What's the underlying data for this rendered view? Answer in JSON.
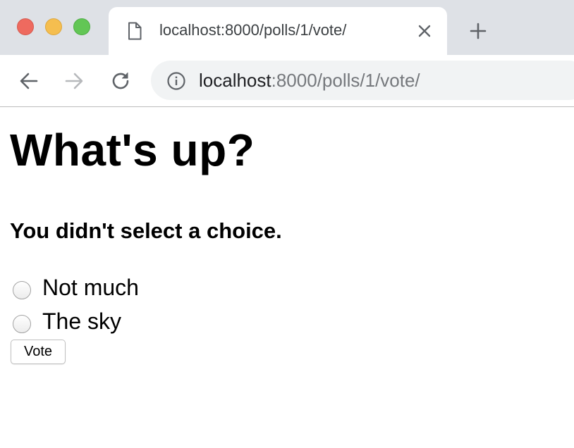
{
  "browser": {
    "tab": {
      "title": "localhost:8000/polls/1/vote/"
    },
    "address_bar": {
      "host": "localhost",
      "rest": ":8000/polls/1/vote/"
    }
  },
  "page": {
    "question": "What's up?",
    "error_message": "You didn't select a choice.",
    "choices": [
      {
        "label": "Not much",
        "selected": false
      },
      {
        "label": "The sky",
        "selected": false
      }
    ],
    "submit_label": "Vote"
  },
  "icons": {
    "page": "page-icon",
    "close": "close-icon",
    "new_tab": "plus-icon",
    "back": "arrow-left-icon",
    "forward": "arrow-right-icon",
    "reload": "reload-icon",
    "info": "info-icon"
  },
  "colors": {
    "tabstrip_bg": "#dee1e6",
    "omnibox_bg": "#f1f3f4",
    "traffic_red": "#ee6a5f",
    "traffic_yellow": "#f5be4f",
    "traffic_green": "#62c655"
  }
}
